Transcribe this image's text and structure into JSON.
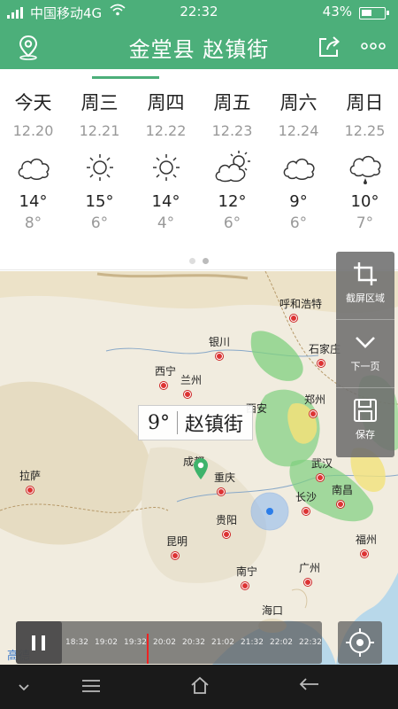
{
  "status_bar": {
    "carrier": "中国移动4G",
    "time": "22:32",
    "battery": "43%"
  },
  "header": {
    "title": "金堂县 赵镇街"
  },
  "forecast": {
    "days": [
      {
        "name": "今天",
        "date": "12.20",
        "icon": "cloudy-icon",
        "high": "14°",
        "low": "8°"
      },
      {
        "name": "周三",
        "date": "12.21",
        "icon": "sunny-icon",
        "high": "15°",
        "low": "6°"
      },
      {
        "name": "周四",
        "date": "12.22",
        "icon": "sunny-icon",
        "high": "14°",
        "low": "4°"
      },
      {
        "name": "周五",
        "date": "12.23",
        "icon": "partly-cloudy-icon",
        "high": "12°",
        "low": "6°"
      },
      {
        "name": "周六",
        "date": "12.24",
        "icon": "cloudy-icon",
        "high": "9°",
        "low": "6°"
      },
      {
        "name": "周日",
        "date": "12.25",
        "icon": "light-rain-icon",
        "high": "10°",
        "low": "7°"
      }
    ]
  },
  "map": {
    "cities": [
      "呼和浩特",
      "银川",
      "石家庄",
      "西宁",
      "兰州",
      "西安",
      "郑州",
      "成都",
      "重庆",
      "武汉",
      "拉萨",
      "长沙",
      "南昌",
      "贵阳",
      "福州",
      "昆明",
      "南宁",
      "广州",
      "海口"
    ],
    "popup": {
      "temp": "9°",
      "place": "赵镇街"
    },
    "watermark": "高德"
  },
  "side_panel": {
    "buttons": [
      "截屏区域",
      "下一页",
      "保存"
    ]
  },
  "timeline": {
    "times": [
      "18:32",
      "19:02",
      "19:32",
      "20:02",
      "20:32",
      "21:02",
      "21:32",
      "22:02",
      "22:32"
    ]
  }
}
